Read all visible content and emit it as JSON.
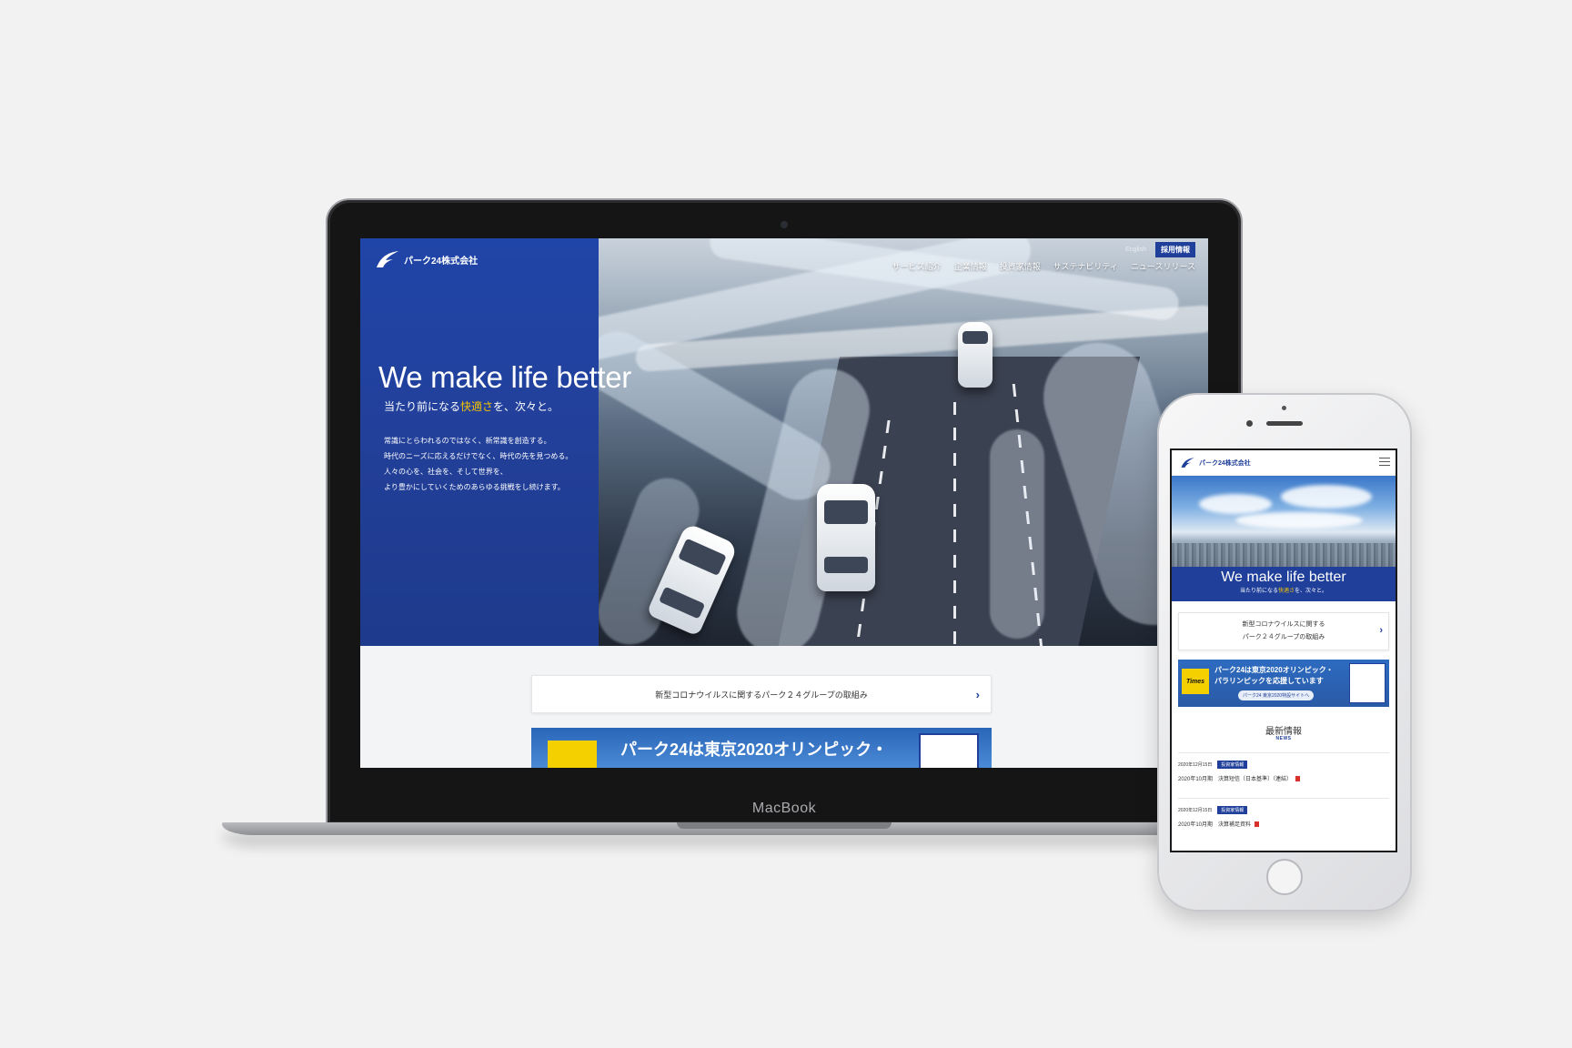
{
  "desktop": {
    "device_label": "MacBook",
    "logo_text": "パーク24株式会社",
    "utility": {
      "english": "English",
      "recruit": "採用情報"
    },
    "nav": [
      "サービス紹介",
      "企業情報",
      "投資家情報",
      "サステナビリティ",
      "ニュースリリース"
    ],
    "hero": {
      "title": "We make life better",
      "subtitle_pre": "当たり前になる",
      "subtitle_accent": "快適さ",
      "subtitle_post": "を、次々と。",
      "body": [
        "常識にとらわれるのではなく、新常識を創造する。",
        "時代のニーズに応えるだけでなく、時代の先を見つめる。",
        "人々の心を、社会を、そして世界を、",
        "より豊かにしていくためのあらゆる挑戦をし続けます。"
      ]
    },
    "covid_link": "新型コロナウイルスに関するパーク２４グループの取組み",
    "olympic_banner": "パーク24は東京2020オリンピック・",
    "chevron": "›"
  },
  "mobile": {
    "logo_text": "パーク24株式会社",
    "hero_title": "We make life better",
    "subtitle_pre": "当たり前になる",
    "subtitle_accent": "快適さ",
    "subtitle_post": "を、次々と。",
    "covid_line1": "新型コロナウイルスに関する",
    "covid_line2": "パーク２４グループの取組み",
    "olympic": {
      "times": "Times",
      "line1": "パーク24は東京2020オリンピック・",
      "line2": "パラリンピックを応援しています",
      "pill": "パーク24 東京2020特設サイトへ"
    },
    "news_title": "最新情報",
    "news_sub": "NEWS",
    "news": [
      {
        "date": "2020年12月15日",
        "tag": "投資家情報",
        "title": "2020年10月期　決算短信〔日本基準〕（連結）"
      },
      {
        "date": "2020年12月15日",
        "tag": "投資家情報",
        "title": "2020年10月期　決算補足資料"
      }
    ],
    "chevron": "›"
  },
  "colors": {
    "brand_blue": "#1f3f9a",
    "accent_yellow": "#f5c400",
    "background": "#f2f2f2"
  }
}
